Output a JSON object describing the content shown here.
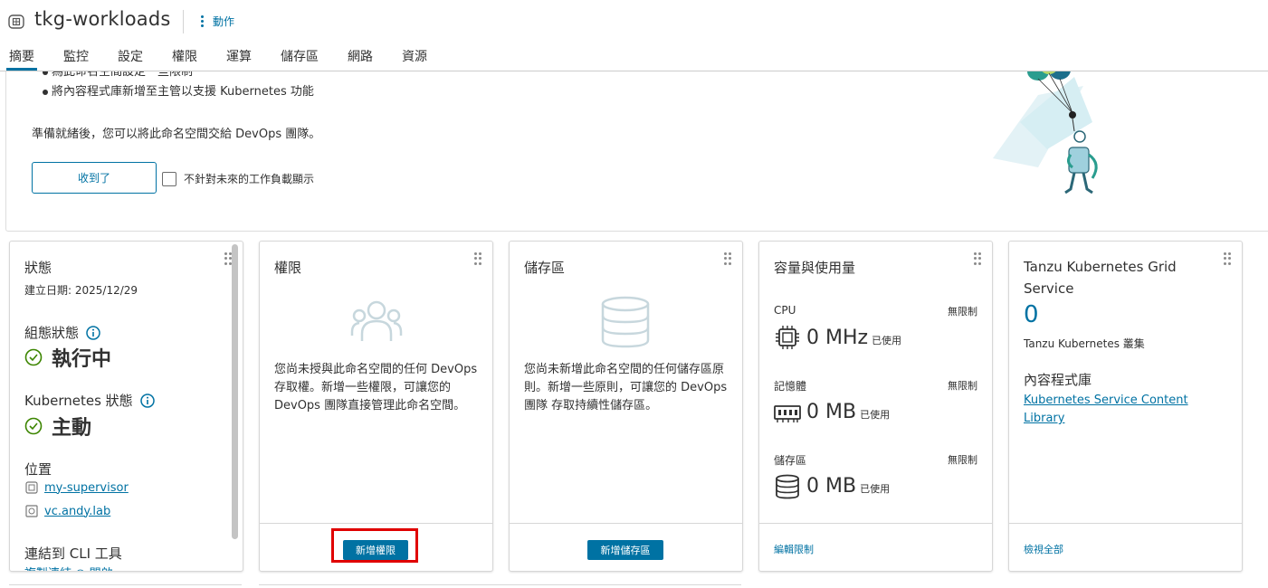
{
  "header": {
    "title": "tkg-workloads",
    "actions_label": "動作"
  },
  "tabs": [
    "摘要",
    "監控",
    "設定",
    "權限",
    "運算",
    "儲存區",
    "網路",
    "資源"
  ],
  "banner": {
    "bullet_1": "為此命名空間設定一些限制",
    "bullet_2": "將內容程式庫新增至主管以支援 Kubernetes 功能",
    "ready_text": "準備就緒後，您可以將此命名空間交給 DevOps 團隊。",
    "got_it_button": "收到了",
    "dont_show_label": "不針對未來的工作負載顯示"
  },
  "status_card": {
    "title": "狀態",
    "created_date": "建立日期: 2025/12/29",
    "config_status_label": "組態狀態",
    "config_status_value": "執行中",
    "k8s_status_label": "Kubernetes 狀態",
    "k8s_status_value": "主動",
    "location_label": "位置",
    "supervisor_link": "my-supervisor",
    "vcenter_link": "vc.andy.lab",
    "cli_label": "連結到 CLI 工具",
    "cli_link_partial": "複製連結 ○ 開啟"
  },
  "permissions_card": {
    "title": "權限",
    "body": "您尚未授與此命名空間的任何 DevOps 存取權。新增一些權限，可讓您的 DevOps 團隊直接管理此命名空間。",
    "button": "新增權限"
  },
  "storage_card": {
    "title": "儲存區",
    "body": "您尚未新增此命名空間的任何儲存區原則。新增一些原則，可讓您的 DevOps 團隊 存取持續性儲存區。",
    "button": "新增儲存區"
  },
  "capacity_card": {
    "title": "容量與使用量",
    "cpu_label": "CPU",
    "cpu_limit": "無限制",
    "cpu_value": "0 MHz",
    "cpu_used": "已使用",
    "memory_label": "記憶體",
    "memory_limit": "無限制",
    "memory_value": "0 MB",
    "memory_used": "已使用",
    "storage_label": "儲存區",
    "storage_limit": "無限制",
    "storage_value": "0 MB",
    "storage_used": "已使用",
    "footer_link": "編輯限制"
  },
  "tkg_card": {
    "title_line1": "Tanzu Kubernetes Grid",
    "title_line2": "Service",
    "count": "0",
    "count_label": "Tanzu Kubernetes 叢集",
    "content_library_label": "內容程式庫",
    "library_link_line1": "Kubernetes Service Content",
    "library_link_line2": "Library",
    "footer_link": "檢視全部"
  },
  "colors": {
    "accent": "#0072a3",
    "success": "#3c8500",
    "highlight": "#e00000"
  }
}
